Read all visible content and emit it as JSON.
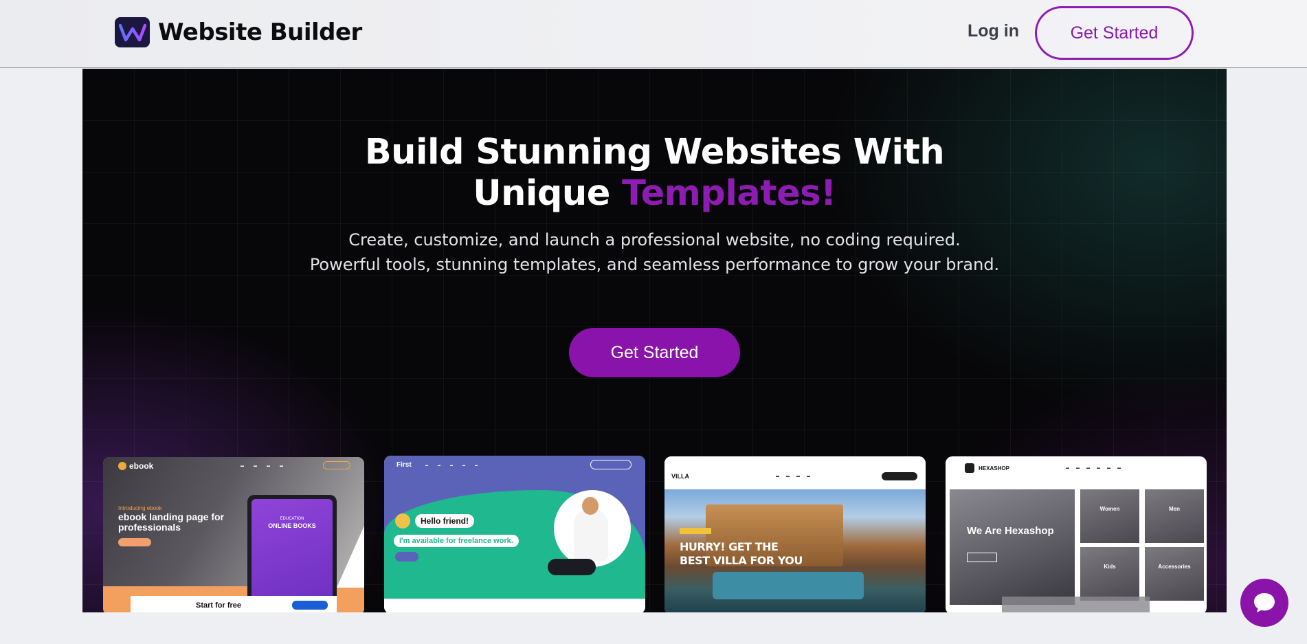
{
  "header": {
    "brand": "Website Builder",
    "login_label": "Log in",
    "cta_label": "Get Started"
  },
  "hero": {
    "title_line1": "Build Stunning Websites With",
    "title_line2_prefix": "Unique ",
    "title_line2_highlight": "Templates!",
    "subtitle_line1": "Create, customize, and launch a professional website, no coding required.",
    "subtitle_line2": "Powerful tools, stunning templates, and seamless performance to grow your brand.",
    "cta_label": "Get Started"
  },
  "templates": [
    {
      "brand": "ebook",
      "kicker": "Introducing ebook",
      "title": "ebook landing page for professionals",
      "tablet_line1": "EDUCATION",
      "tablet_line2": "ONLINE BOOKS",
      "ad_text": "Start for free"
    },
    {
      "brand": "First",
      "greeting": "Hello friend!",
      "tagline": "I'm available for freelance work."
    },
    {
      "brand": "VILLA",
      "headline": "HURRY! GET THE BEST VILLA FOR YOU"
    },
    {
      "brand": "HEXASHOP",
      "headline": "We Are Hexashop",
      "tiles": [
        "Women",
        "Men",
        "Kids",
        "Accessories"
      ]
    }
  ],
  "colors": {
    "accent": "#8913ab",
    "hero_bg": "#070608",
    "header_bg": "#eeeff2"
  },
  "icons": {
    "logo": "w-logo-icon",
    "chat": "chat-bubble-icon"
  }
}
